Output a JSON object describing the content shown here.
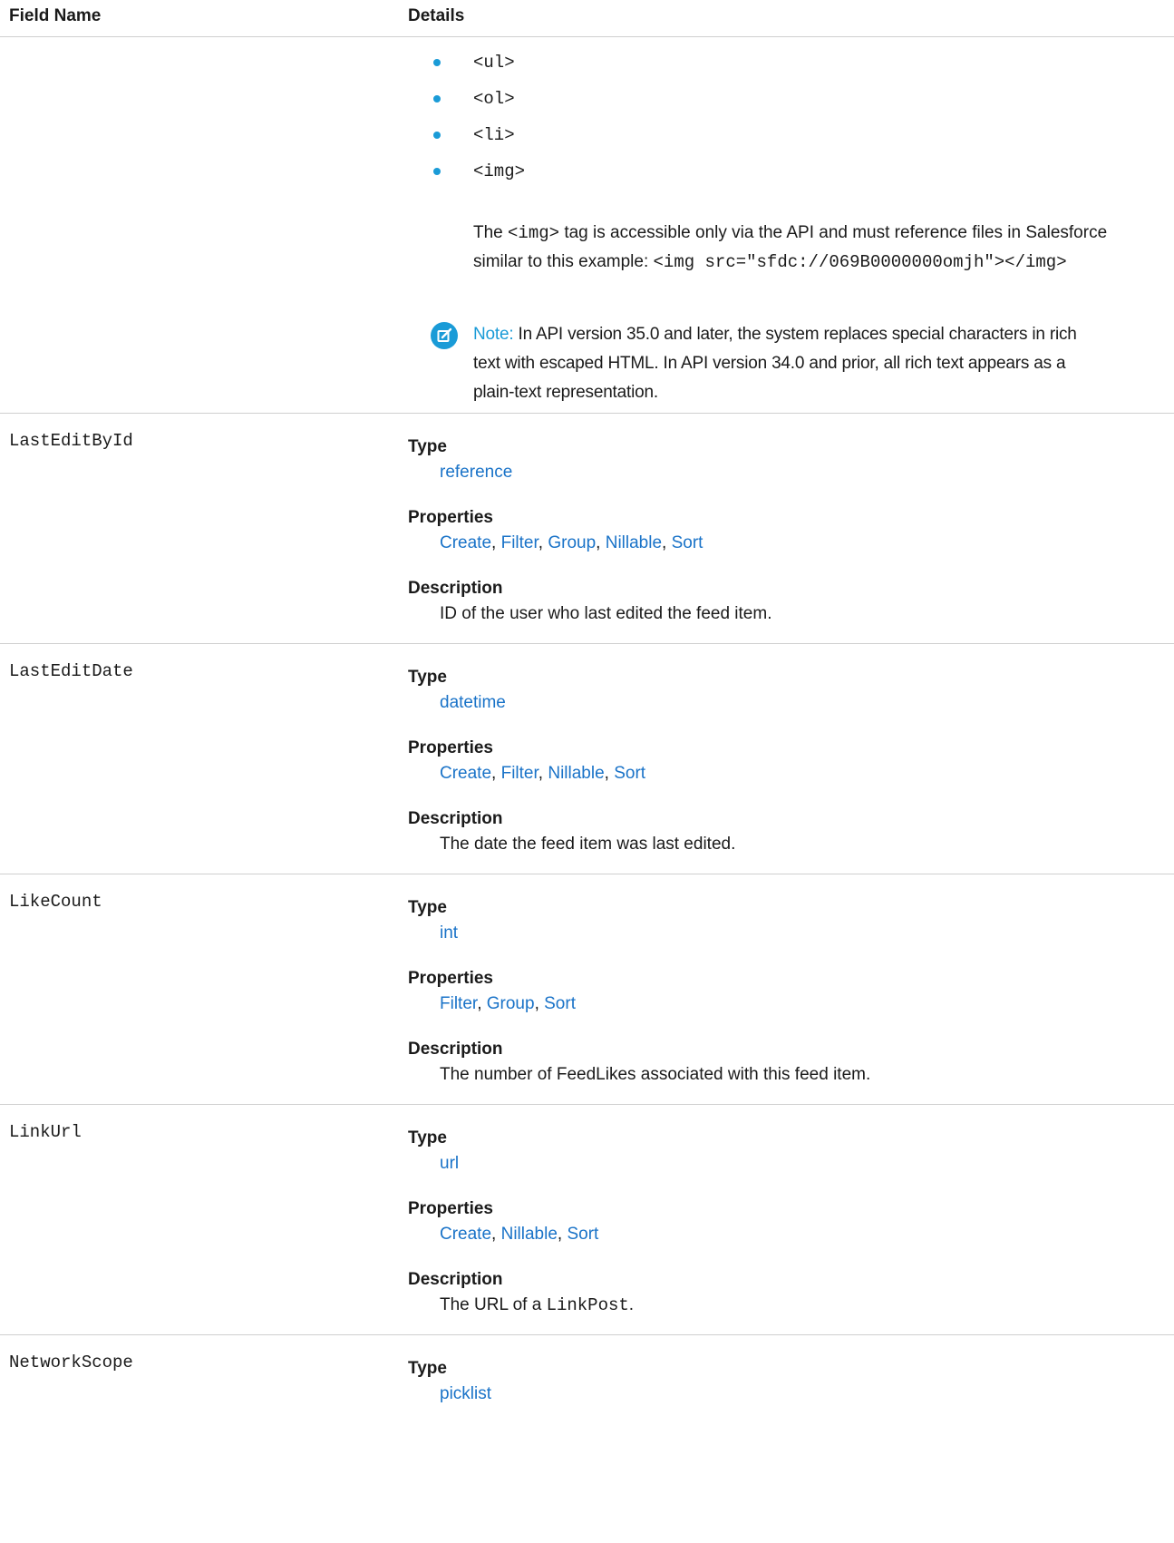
{
  "header": {
    "field_name": "Field Name",
    "details": "Details"
  },
  "continuation": {
    "bullets": [
      "<ul>",
      "<ol>",
      "<li>",
      "<img>"
    ],
    "img_paragraph": {
      "text1": "The ",
      "tag": "<img>",
      "text2": " tag is accessible only via the API and must reference files in Salesforce similar to this example: ",
      "example": "<img src=\"sfdc://069B0000000omjh\"></img>"
    },
    "note": {
      "label": "Note:",
      "text": " In API version 35.0 and later, the system replaces special characters in rich text with escaped HTML. In API version 34.0 and prior, all rich text appears as a plain-text representation."
    }
  },
  "fields": [
    {
      "name": "LastEditById",
      "type_label": "Type",
      "type": "reference",
      "properties_label": "Properties",
      "properties": [
        "Create",
        "Filter",
        "Group",
        "Nillable",
        "Sort"
      ],
      "description_label": "Description",
      "description": "ID of the user who last edited the feed item."
    },
    {
      "name": "LastEditDate",
      "type_label": "Type",
      "type": "datetime",
      "properties_label": "Properties",
      "properties": [
        "Create",
        "Filter",
        "Nillable",
        "Sort"
      ],
      "description_label": "Description",
      "description": "The date the feed item was last edited."
    },
    {
      "name": "LikeCount",
      "type_label": "Type",
      "type": "int",
      "properties_label": "Properties",
      "properties": [
        "Filter",
        "Group",
        "Sort"
      ],
      "description_label": "Description",
      "description": "The number of FeedLikes associated with this feed item."
    },
    {
      "name": "LinkUrl",
      "type_label": "Type",
      "type": "url",
      "properties_label": "Properties",
      "properties": [
        "Create",
        "Nillable",
        "Sort"
      ],
      "description_label": "Description",
      "description_prefix": "The URL of a ",
      "description_code": "LinkPost",
      "description_suffix": "."
    },
    {
      "name": "NetworkScope",
      "type_label": "Type",
      "type": "picklist"
    }
  ]
}
